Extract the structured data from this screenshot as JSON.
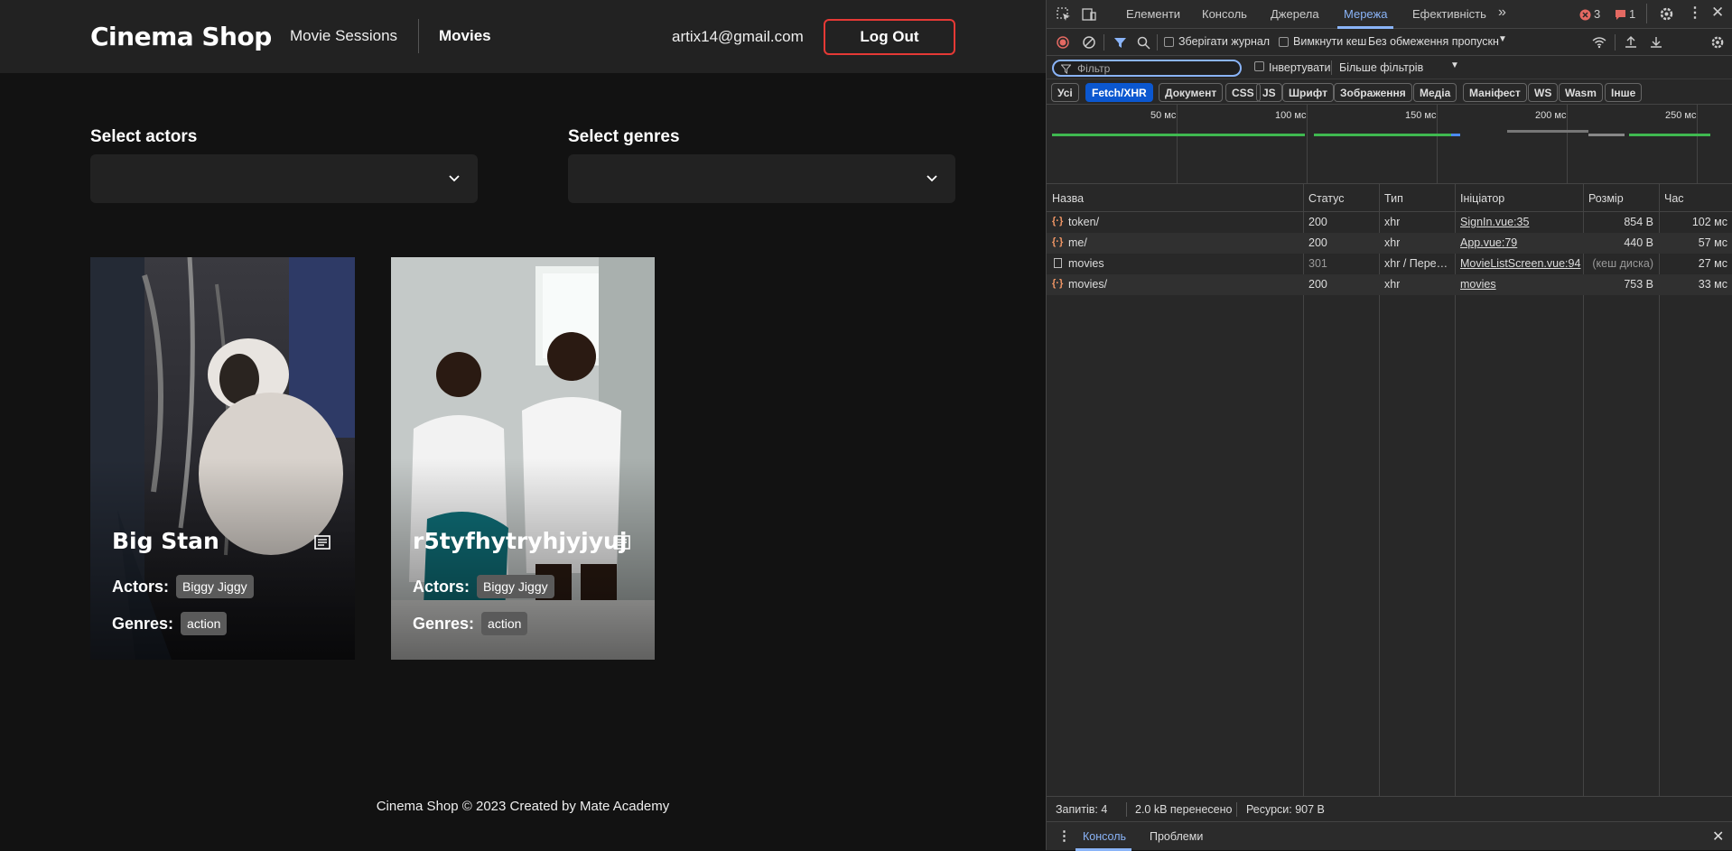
{
  "header": {
    "logo": "Cinema Shop",
    "nav": [
      "Movie Sessions",
      "Movies"
    ],
    "email": "artix14@gmail.com",
    "logout_label": "Log Out"
  },
  "filters": {
    "actors_label": "Select actors",
    "genres_label": "Select genres"
  },
  "movies": [
    {
      "title": "Big Stan",
      "actors_label": "Actors:",
      "actor": "Biggy Jiggy",
      "genres_label": "Genres:",
      "genre": "action"
    },
    {
      "title": "r5tyfhytryhjyjyuj",
      "actors_label": "Actors:",
      "actor": "Biggy Jiggy",
      "genres_label": "Genres:",
      "genre": "action"
    }
  ],
  "footer": "Cinema Shop © 2023 Created by Mate Academy",
  "devtools": {
    "tabs": [
      "Елементи",
      "Консоль",
      "Джерела",
      "Мережа",
      "Ефективність"
    ],
    "active_tab": "Мережа",
    "error_count": "3",
    "issue_count": "1",
    "preserve_log": "Зберігати журнал",
    "disable_cache": "Вимкнути кеш",
    "throttling": "Без обмеження пропускн",
    "filter_placeholder": "Фільтр",
    "invert": "Інвертувати",
    "more_filters": "Більше фільтрів",
    "type_chips": [
      "Усі",
      "Fetch/XHR",
      "Документ",
      "CSS",
      "JS",
      "Шрифт",
      "Зображення",
      "Медіа",
      "Маніфест",
      "WS",
      "Wasm",
      "Інше"
    ],
    "active_chip": "Fetch/XHR",
    "timeline_ticks": [
      "50 мс",
      "100 мс",
      "150 мс",
      "200 мс",
      "250 мс"
    ],
    "columns": [
      "Назва",
      "Статус",
      "Тип",
      "Ініціатор",
      "Розмір",
      "Час"
    ],
    "requests": [
      {
        "name": "token/",
        "status": "200",
        "type": "xhr",
        "initiator": "SignIn.vue:35",
        "size": "854 B",
        "time": "102 мс",
        "kind": "xhr"
      },
      {
        "name": "me/",
        "status": "200",
        "type": "xhr",
        "initiator": "App.vue:79",
        "size": "440 B",
        "time": "57 мс",
        "kind": "xhr"
      },
      {
        "name": "movies",
        "status": "301",
        "type": "xhr / Пере…",
        "initiator": "MovieListScreen.vue:94",
        "size": "(кеш диска)",
        "time": "27 мс",
        "kind": "doc"
      },
      {
        "name": "movies/",
        "status": "200",
        "type": "xhr",
        "initiator": "movies",
        "size": "753 B",
        "time": "33 мс",
        "kind": "xhr"
      }
    ],
    "summary": [
      "Запитів: 4",
      "2.0 kB перенесено",
      "Ресурси: 907 B"
    ],
    "drawer_tabs": [
      "Консоль",
      "Проблеми"
    ],
    "accent": "#8ab4f8"
  }
}
